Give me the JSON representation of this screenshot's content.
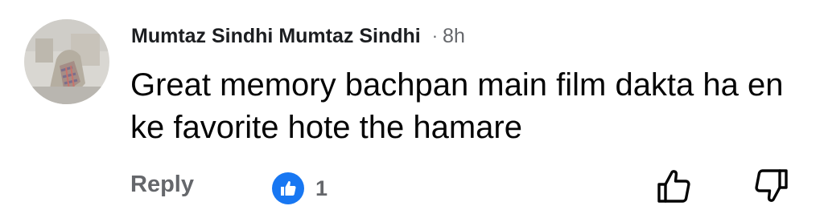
{
  "comment": {
    "author": "Mumtaz Sindhi Mumtaz Sindhi",
    "separator": "·",
    "time": "8h",
    "text": "Great memory bachpan main film dakta ha en ke favorite hote the hamare"
  },
  "actions": {
    "reply_label": "Reply",
    "reaction_count": "1",
    "reaction_icon": "like-icon",
    "upvote_icon": "thumbs-up-outline-icon",
    "downvote_icon": "thumbs-down-outline-icon"
  },
  "colors": {
    "like_blue": "#1877f2",
    "secondary_text": "#65676b",
    "primary_text": "#050505"
  }
}
